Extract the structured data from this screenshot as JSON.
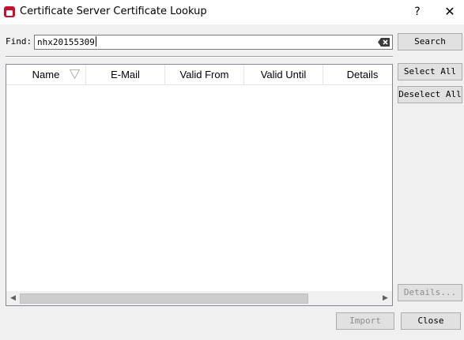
{
  "window": {
    "title": "Certificate Server Certificate Lookup",
    "help_label": "?",
    "close_label": "✕"
  },
  "find": {
    "label": "Find:",
    "value": "nhx20155309"
  },
  "buttons": {
    "search": "Search",
    "select_all": "Select All",
    "deselect_all": "Deselect All",
    "details": "Details...",
    "import": "Import",
    "close": "Close"
  },
  "table": {
    "columns": [
      "Name",
      "E-Mail",
      "Valid From",
      "Valid Until",
      "Details"
    ],
    "rows": []
  },
  "icons": {
    "app": "certificate-app-icon",
    "clear": "clear-text-icon",
    "sort": "sort-indicator-icon",
    "scroll_left": "scroll-left-arrow-icon",
    "scroll_right": "scroll-right-arrow-icon"
  },
  "colors": {
    "app_icon_accent": "#c8102e",
    "dialog_background": "#f0f0f0",
    "button_background": "#e1e1e1"
  }
}
